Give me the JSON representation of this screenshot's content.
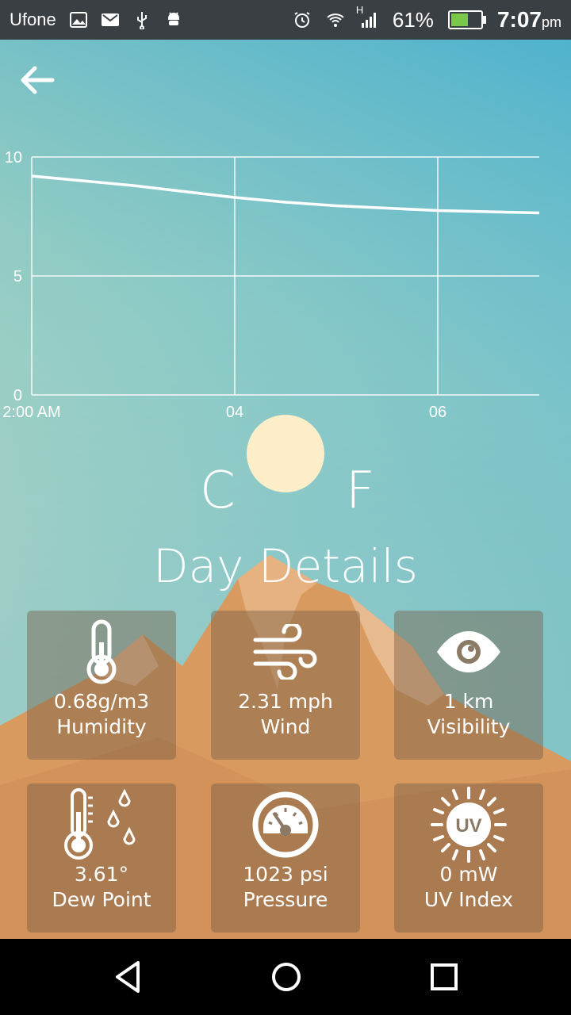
{
  "status_bar": {
    "carrier": "Ufone",
    "network": "H",
    "battery": "61%",
    "battery_level": 0.61,
    "time": "7:07",
    "time_suffix": "pm",
    "icons": [
      "image-icon",
      "gmail-icon",
      "usb-icon",
      "android-icon",
      "alarm-icon",
      "wifi-icon",
      "signal-icon",
      "battery-charging-icon"
    ]
  },
  "header": {
    "back_icon": "back-arrow-icon"
  },
  "chart_data": {
    "type": "line",
    "x": [
      "2:00 AM",
      "02:30",
      "03:00",
      "03:30",
      "04:00",
      "04:30",
      "05:00",
      "05:30",
      "06:00",
      "06:30",
      "07:00"
    ],
    "values": [
      9.2,
      9.0,
      8.8,
      8.55,
      8.3,
      8.1,
      7.95,
      7.85,
      7.75,
      7.7,
      7.65
    ],
    "tick_labels_x": [
      "2:00 AM",
      "04",
      "06"
    ],
    "tick_labels_y": [
      "0",
      "5",
      "10"
    ],
    "ylim": [
      0,
      10
    ],
    "grid": true,
    "line_color": "#ffffff"
  },
  "units": {
    "celsius": "C",
    "fahrenheit": "F",
    "sun_color": "#fdeec9"
  },
  "title": "Day Details",
  "details": [
    {
      "icon": "thermometer-icon",
      "value": "0.68g/m3",
      "label": "Humidity"
    },
    {
      "icon": "wind-icon",
      "value": "2.31 mph",
      "label": "Wind"
    },
    {
      "icon": "eye-icon",
      "value": "1 km",
      "label": "Visibility"
    },
    {
      "icon": "dew-point-icon",
      "value": "3.61°",
      "label": "Dew Point"
    },
    {
      "icon": "gauge-icon",
      "value": "1023 psi",
      "label": "Pressure"
    },
    {
      "icon": "uv-icon",
      "value": "0 mW",
      "label": "UV Index"
    }
  ],
  "nav": {
    "back": "back-triangle-icon",
    "home": "home-circle-icon",
    "recents": "recents-square-icon"
  },
  "colors": {
    "mountain": "#d99a5f",
    "tile": "#785f46",
    "sky_top": "#4fb2ce"
  }
}
